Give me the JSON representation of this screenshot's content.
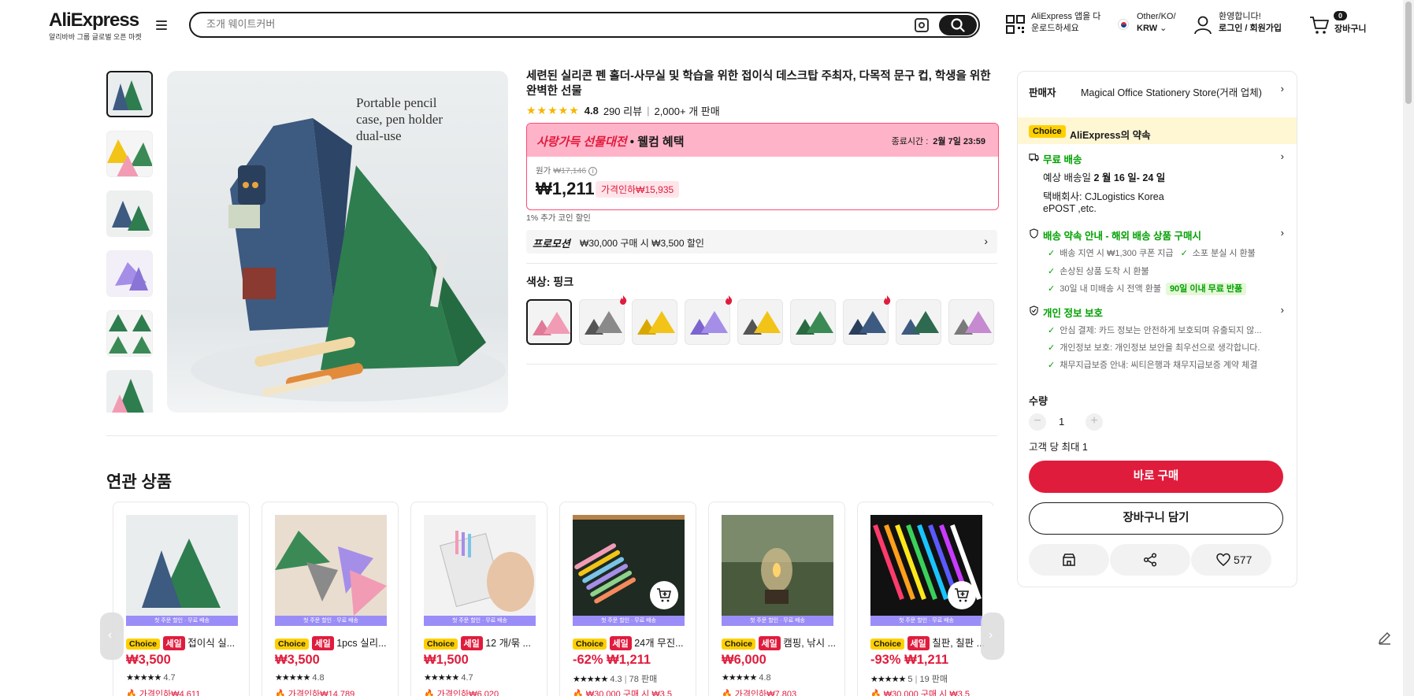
{
  "header": {
    "logo": "AliExpress",
    "logo_sub": "알리바바 그룹 글로벌 오픈 마켓",
    "search_placeholder": "조개 웨이트커버",
    "app_line1": "AliExpress 앱을 다",
    "app_line2": "운로드하세요",
    "region_line1": "Other/KO/",
    "region_line2": "KRW",
    "user_line1": "환영합니다!",
    "user_line2": "로그인 / 회원가입",
    "cart_count": "0",
    "cart_label": "장바구니"
  },
  "product": {
    "image_caption": "Portable pencil case, pen holder dual-use",
    "title": "세련된 실리콘 펜 홀더-사무실 및 학습을 위한 접이식 데스크탑 주최자, 다목적 문구 컵, 학생을 위한 완벽한 선물",
    "rating": "4.8",
    "reviews": "290 리뷰",
    "sold": "2,000+ 개 판매",
    "promo_title_red": "사랑가득 선물대전",
    "promo_title_rest": " • 웰컴 혜택",
    "deadline_label": "종료시간 :",
    "deadline": "2월 7일 23:59",
    "orig_label": "원가",
    "orig_price": "₩17,146",
    "price": "₩1,211",
    "discount": "가격인하₩15,935",
    "coin_text": "1% 추가 코인 할인",
    "promotion_label": "프로모션",
    "promotion_text": "₩30,000 구매 시 ₩3,500 할인",
    "color_label": "색상: 핑크",
    "swatches": [
      {
        "color": "#f29bb4",
        "dark": "#e07a98",
        "hot": false
      },
      {
        "color": "#8a8a8a",
        "dark": "#555555",
        "hot": true
      },
      {
        "color": "#f2c418",
        "dark": "#d8a800",
        "hot": false
      },
      {
        "color": "#a58ee8",
        "dark": "#7c64d0",
        "hot": true
      },
      {
        "color": "#f2c418",
        "dark": "#555555",
        "hot": false
      },
      {
        "color": "#3b8a55",
        "dark": "#2a6a40",
        "hot": false
      },
      {
        "color": "#3d5a80",
        "dark": "#2a3f5c",
        "hot": true
      },
      {
        "color": "#2d6a4f",
        "dark": "#3d5a80",
        "hot": false
      },
      {
        "color": "#c58ad0",
        "dark": "#7a7a7a",
        "hot": false
      }
    ]
  },
  "side": {
    "seller_label": "판매자",
    "seller_name": "Magical Office Stationery Store(거래 업체)",
    "choice_badge": "Choice",
    "choice_text": "AliExpress의 약속",
    "shipping_title": "무료 배송",
    "delivery_prefix": "예상 배송일",
    "delivery_date": "2 월 16 일- 24 일",
    "carrier_line1": "택배회사:  CJLogistics   Korea",
    "carrier_line2": "ePOST ,etc.",
    "promise_title": "배송 약속 안내 - 해외 배송 상품 구매시",
    "promise_1a": "배송 지연 시 ₩1,300 쿠폰 지급",
    "promise_1b": "소포 분실 시 환불",
    "promise_2": "손상된 상품 도착 시 환불",
    "promise_3": "30일 내 미배송 시 전액 환불",
    "promise_3_tag": "90일 이내 무료 반품",
    "privacy_title": "개인 정보 보호",
    "privacy_1": "안심 결제: 카드 정보는 안전하게 보호되며 유출되지 않...",
    "privacy_2": "개인정보 보호: 개인정보 보안을 최우선으로 생각합니다.",
    "privacy_3": "채무지급보증 안내: 씨티은행과 채무지급보증 계약 체결",
    "qty_label": "수량",
    "qty_minus": "−",
    "qty_plus": "+",
    "qty": "1",
    "qty_max": "고객 당 최대 1",
    "buy_label": "바로 구매",
    "cart_label": "장바구니 담기",
    "wish_count": "577"
  },
  "related": {
    "title": "연관 상품",
    "strip_text": "첫 주문 할인 · 무료 배송",
    "items": [
      {
        "name": "접이식 실...",
        "sale": true,
        "price": "₩3,500",
        "pct": "",
        "rating": "4.7",
        "sold": "",
        "extra": "가격인하₩4,611",
        "img": "a"
      },
      {
        "name": "1pcs 실리...",
        "sale": true,
        "price": "₩3,500",
        "pct": "",
        "rating": "4.8",
        "sold": "",
        "extra": "가격인하₩14,789",
        "img": "b"
      },
      {
        "name": "12 개/묶 ...",
        "sale": true,
        "price": "₩1,500",
        "pct": "",
        "rating": "4.7",
        "sold": "",
        "extra": "가격인하₩6,020",
        "img": "c"
      },
      {
        "name": "24개 무진...",
        "sale": true,
        "price": "₩1,211",
        "pct": "-62%",
        "rating": "4.3",
        "sold": "78 판매",
        "extra": "₩30,000 구매 시 ₩3,5",
        "img": "d"
      },
      {
        "name": "캠핑, 낚시 ...",
        "sale": true,
        "price": "₩6,000",
        "pct": "",
        "rating": "4.8",
        "sold": "",
        "extra": "가격인하₩7,803",
        "img": "e"
      },
      {
        "name": "칠판, 칠판 ...",
        "sale": true,
        "price": "₩1,211",
        "pct": "-93%",
        "rating": "5",
        "sold": "19 판매",
        "extra": "₩30,000 구매 시 ₩3,5",
        "img": "f"
      }
    ]
  }
}
